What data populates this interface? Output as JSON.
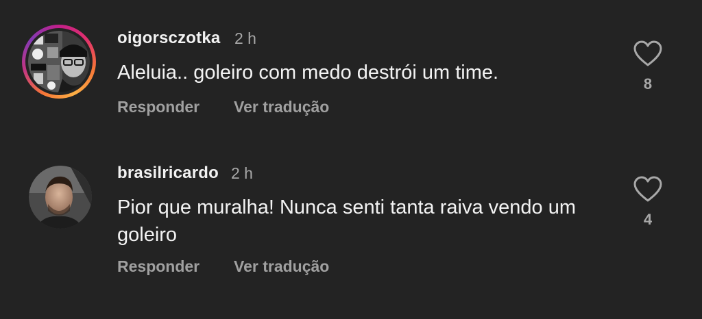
{
  "comments": [
    {
      "username": "oigorsczotka",
      "time": "2 h",
      "text": "Aleluia.. goleiro com medo destrói um time.",
      "reply_label": "Responder",
      "translate_label": "Ver tradução",
      "likes": "8",
      "has_story_ring": true
    },
    {
      "username": "brasilricardo",
      "time": "2 h",
      "text": "Pior que muralha! Nunca senti tanta raiva vendo um goleiro",
      "reply_label": "Responder",
      "translate_label": "Ver tradução",
      "likes": "4",
      "has_story_ring": false
    }
  ],
  "colors": {
    "background": "#232323",
    "text": "#f3f3f3",
    "secondary_text": "#a8a8a8",
    "story_ring": [
      "#c21f8a",
      "#e1306c",
      "#f77737",
      "#fcaf45"
    ]
  },
  "icons": {
    "like": "heart-outline-icon"
  }
}
